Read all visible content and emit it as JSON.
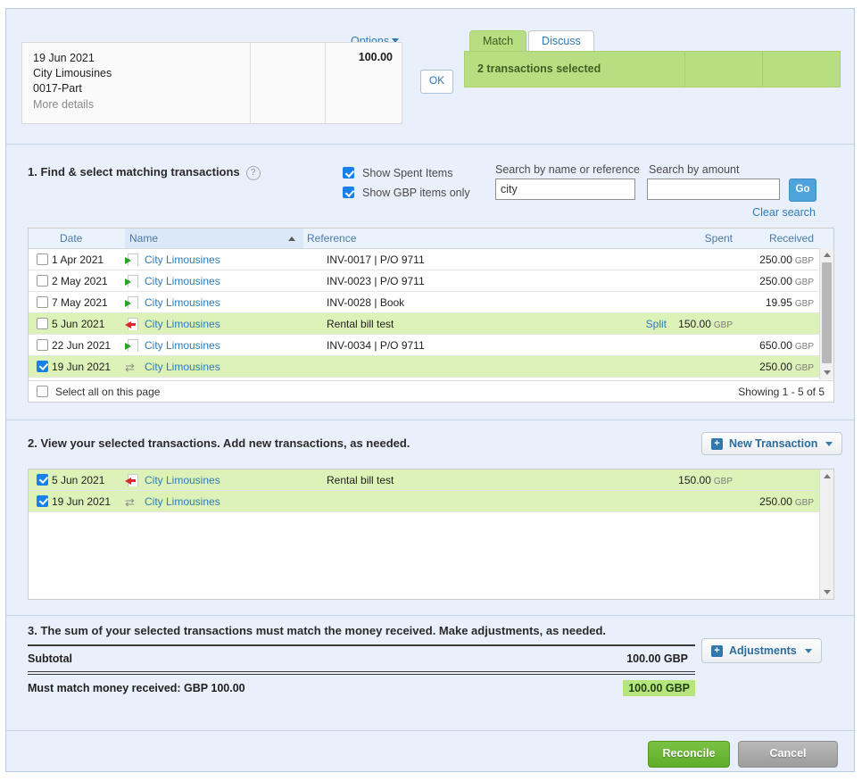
{
  "top": {
    "options_label": "Options",
    "statement": {
      "date": "19 Jun 2021",
      "payee": "City Limousines",
      "reference": "0017-Part",
      "more_details": "More details",
      "amount": "100.00"
    },
    "ok_label": "OK",
    "tabs": [
      {
        "label": "Match",
        "active": true
      },
      {
        "label": "Discuss",
        "active": false
      }
    ],
    "selection_banner": "2 transactions selected"
  },
  "section1": {
    "heading": "1. Find & select matching transactions",
    "help_icon": "?",
    "filters": [
      {
        "label": "Show Spent Items",
        "checked": true
      },
      {
        "label": "Show GBP items only",
        "checked": true
      }
    ],
    "search": {
      "name_label": "Search by name or reference",
      "amount_label": "Search by amount",
      "name_value": "city",
      "amount_value": "",
      "go_label": "Go",
      "clear_label": "Clear search"
    },
    "columns": {
      "date": "Date",
      "name": "Name",
      "reference": "Reference",
      "spent": "Spent",
      "received": "Received"
    },
    "sorted_column": "Name",
    "sort_direction": "asc",
    "rows": [
      {
        "checked": false,
        "highlighted": false,
        "date": "1 Apr 2021",
        "icon": "invoice-in-icon",
        "name": "City Limousines",
        "reference": "INV-0017 | P/O 9711",
        "split": "",
        "spent": "",
        "spent_cur": "",
        "received": "250.00",
        "received_cur": "GBP"
      },
      {
        "checked": false,
        "highlighted": false,
        "date": "2 May 2021",
        "icon": "invoice-in-icon",
        "name": "City Limousines",
        "reference": "INV-0023 | P/O 9711",
        "split": "",
        "spent": "",
        "spent_cur": "",
        "received": "250.00",
        "received_cur": "GBP"
      },
      {
        "checked": false,
        "highlighted": false,
        "date": "7 May 2021",
        "icon": "invoice-in-icon",
        "name": "City Limousines",
        "reference": "INV-0028 | Book",
        "split": "",
        "spent": "",
        "spent_cur": "",
        "received": "19.95",
        "received_cur": "GBP"
      },
      {
        "checked": false,
        "highlighted": true,
        "date": "5 Jun 2021",
        "icon": "bill-out-icon",
        "name": "City Limousines",
        "reference": "Rental bill test",
        "split": "Split",
        "spent": "150.00",
        "spent_cur": "GBP",
        "received": "",
        "received_cur": ""
      },
      {
        "checked": false,
        "highlighted": false,
        "date": "22 Jun 2021",
        "icon": "invoice-in-icon",
        "name": "City Limousines",
        "reference": "INV-0034 | P/O 9711",
        "split": "",
        "spent": "",
        "spent_cur": "",
        "received": "650.00",
        "received_cur": "GBP"
      },
      {
        "checked": true,
        "highlighted": true,
        "date": "19 Jun 2021",
        "icon": "transfer-icon",
        "name": "City Limousines",
        "reference": "",
        "split": "",
        "spent": "",
        "spent_cur": "",
        "received": "250.00",
        "received_cur": "GBP"
      }
    ],
    "select_all_label": "Select all on this page",
    "showing_label": "Showing 1 - 5 of 5"
  },
  "section2": {
    "heading": "2. View your selected transactions. Add new transactions, as needed.",
    "new_transaction_label": "New Transaction",
    "plus_glyph": "+",
    "rows": [
      {
        "checked": true,
        "highlighted": true,
        "date": "5 Jun 2021",
        "icon": "bill-out-icon",
        "name": "City Limousines",
        "reference": "Rental bill test",
        "spent": "150.00",
        "spent_cur": "GBP",
        "received": "",
        "received_cur": ""
      },
      {
        "checked": true,
        "highlighted": true,
        "date": "19 Jun 2021",
        "icon": "transfer-icon",
        "name": "City Limousines",
        "reference": "",
        "spent": "",
        "spent_cur": "",
        "received": "250.00",
        "received_cur": "GBP"
      }
    ]
  },
  "section3": {
    "heading": "3. The sum of your selected transactions must match the money received. Make adjustments, as needed.",
    "adjustments_label": "Adjustments",
    "plus_glyph": "+",
    "subtotal_label": "Subtotal",
    "subtotal_amount": "100.00 GBP",
    "match_label": "Must match money received: GBP 100.00",
    "match_amount": "100.00 GBP"
  },
  "footer": {
    "reconcile_label": "Reconcile",
    "cancel_label": "Cancel"
  },
  "colors": {
    "panel_bg": "#eaf0fb",
    "highlight_green": "#ddf2b8",
    "banner_green": "#b7de81",
    "match_green": "#b7e57d",
    "link_blue": "#2e7ab8",
    "checkbox_blue": "#1a7fe8",
    "reconcile_green": "#6fb832",
    "cancel_grey": "#a8a8a8"
  }
}
